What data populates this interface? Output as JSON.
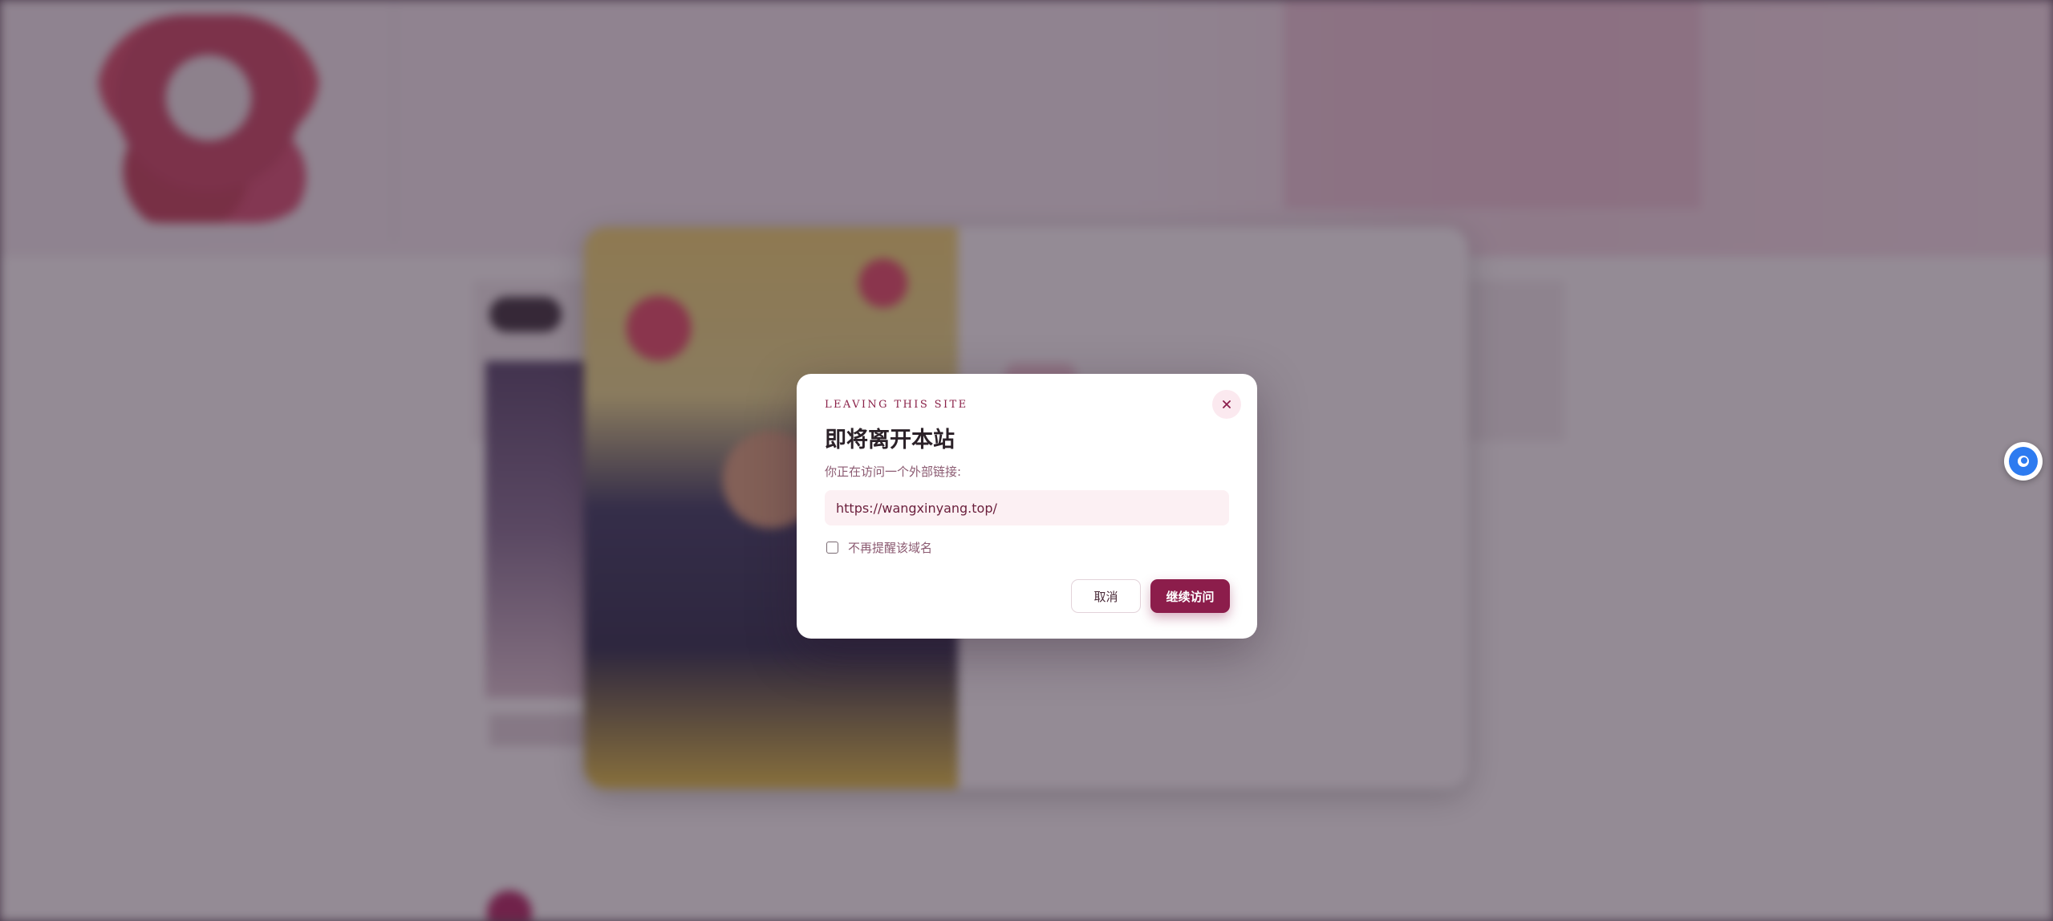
{
  "dialog": {
    "eyebrow": "LEAVING THIS SITE",
    "title": "即将离开本站",
    "description": "你正在访问一个外部链接:",
    "url": "https://wangxinyang.top/",
    "checkbox_label": "不再提醒该域名",
    "checkbox_checked": false,
    "cancel_label": "取消",
    "continue_label": "继续访问",
    "close_icon": "close-icon"
  },
  "colors": {
    "accent": "#8c1d4b",
    "overlay": "rgba(60, 44, 62, 0.55)",
    "url_box_bg": "#fcf0f3",
    "floating_button": "#2d7bf0"
  },
  "floating_button": {
    "icon": "chat-bubble-icon"
  }
}
